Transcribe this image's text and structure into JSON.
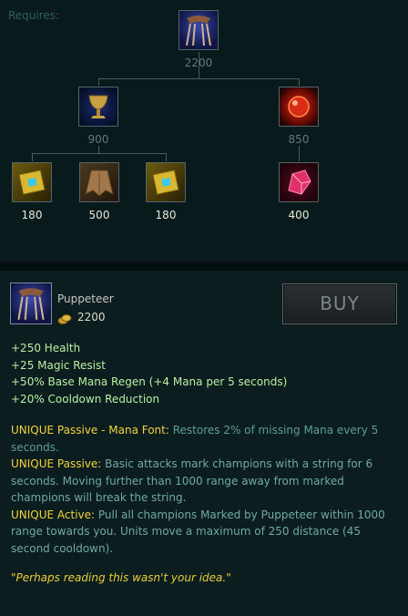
{
  "tree": {
    "requires_label": "Requires:",
    "root": {
      "icon": "puppeteer-icon",
      "cost": "2200"
    },
    "components": [
      {
        "icon": "chalice-icon",
        "cost": "900"
      },
      {
        "icon": "red-gem-icon",
        "cost": "850"
      }
    ],
    "subcomponents": [
      {
        "icon": "gold-book-icon",
        "cost": "180"
      },
      {
        "icon": "cloak-icon",
        "cost": "500"
      },
      {
        "icon": "gold-book-icon",
        "cost": "180"
      },
      {
        "icon": "ruby-crystal-icon",
        "cost": "400"
      }
    ]
  },
  "item": {
    "name": "Puppeteer",
    "price": "2200",
    "buy_label": "BUY",
    "stats": [
      "+250 Health",
      "+25 Magic Resist",
      "+50% Base Mana Regen (+4 Mana per 5 seconds)",
      "+20% Cooldown Reduction"
    ],
    "uniques": [
      {
        "label": "UNIQUE Passive - Mana Font:",
        "text": " Restores 2% of missing Mana every 5 seconds."
      },
      {
        "label": "UNIQUE Passive:",
        "text": " Basic attacks mark champions with a string for 6 seconds. Moving further than 1000 range away from marked champions will break the string."
      },
      {
        "label": "UNIQUE Active:",
        "text": " Pull all champions Marked by Puppeteer within 1000 range towards you. Units move a maximum of 250 distance (45 second cooldown)."
      }
    ],
    "quote": "\"Perhaps reading this wasn't your idea.\""
  }
}
